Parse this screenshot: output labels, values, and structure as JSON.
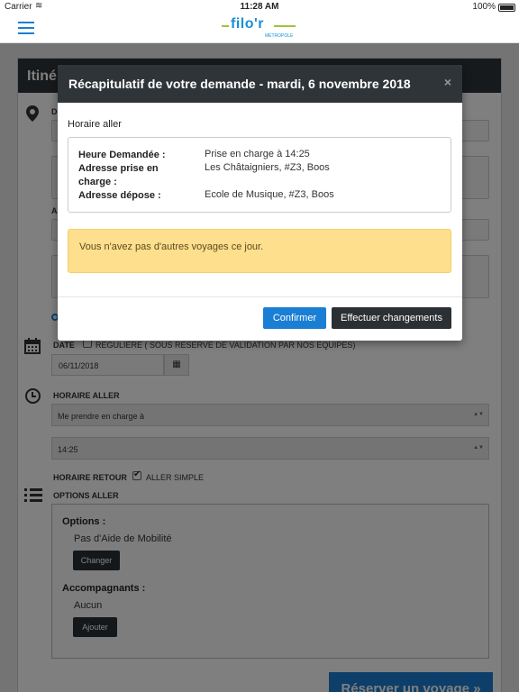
{
  "status_bar": {
    "carrier": "Carrier",
    "time": "11:28 AM",
    "battery": "100%"
  },
  "brand": {
    "logo_text": "filo'r",
    "logo_sub": "MÉTROPOLE",
    "accent_color": "#1a8fd6",
    "green_color": "#9cc43b"
  },
  "page": {
    "panel_title": "Itinéraire",
    "field_label_1": "D",
    "field_label_2": "A",
    "date_label": "DATE",
    "regular_label": "REGULIERE ( SOUS RESERVE DE VALIDATION PAR NOS EQUIPES)",
    "date_value": "06/11/2018",
    "horaire_aller_label": "HORAIRE ALLER",
    "pickup_mode": "Me prendre en charge à",
    "time_value": "14:25",
    "horaire_retour_label": "HORAIRE RETOUR",
    "aller_simple_label": "ALLER SIMPLE",
    "options_aller_label": "OPTIONS ALLER",
    "options_title": "Options :",
    "options_value": "Pas d'Aide de Mobilité",
    "change_button": "Changer",
    "accompagnants_title": "Accompagnants :",
    "accompagnants_value": "Aucun",
    "add_button": "Ajouter",
    "reserve_button": "Réserver un voyage »"
  },
  "modal": {
    "title": "Récapitulatif de votre demande - mardi, 6 novembre 2018",
    "close_glyph": "×",
    "section_title": "Horaire aller",
    "rows": [
      {
        "label": "Heure Demandée :",
        "value": "Prise en charge à 14:25"
      },
      {
        "label": "Adresse prise en charge :",
        "value": "Les Châtaigniers, #Z3, Boos"
      },
      {
        "label": "Adresse dépose :",
        "value": "Ecole de Musique, #Z3, Boos"
      }
    ],
    "alert_text": "Vous n'avez pas d'autres voyages ce jour.",
    "confirm_button": "Confirmer",
    "change_button": "Effectuer changements"
  }
}
